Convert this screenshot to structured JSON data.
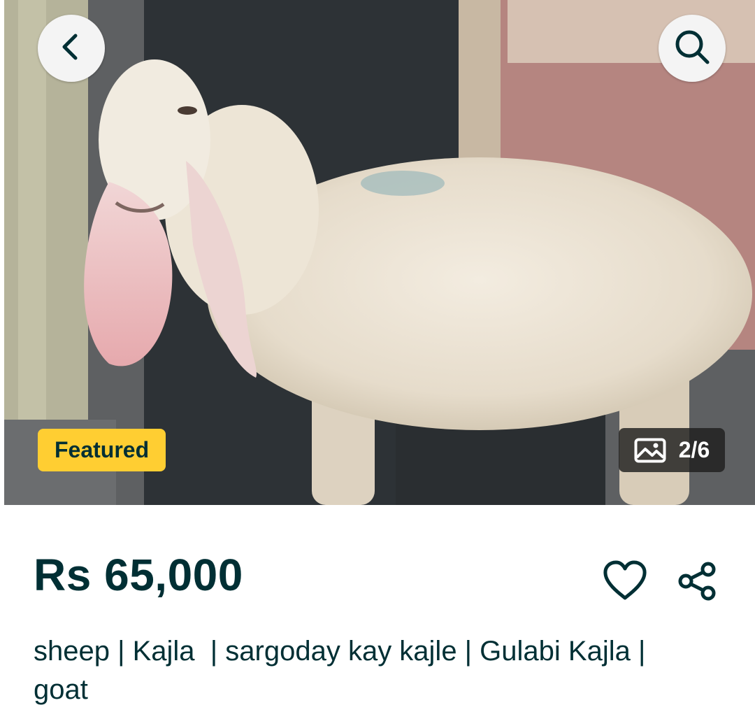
{
  "listing": {
    "badge": "Featured",
    "image_counter": "2/6",
    "price": "Rs 65,000",
    "title": "sheep | Kajla  | sargoday kay kajle | Gulabi Kajla | goat"
  },
  "icons": {
    "back": "chevron-left-icon",
    "search": "search-icon",
    "gallery": "image-icon",
    "favorite": "heart-icon",
    "share": "share-icon"
  },
  "colors": {
    "brand_text": "#002f34",
    "badge_bg": "#ffce32",
    "counter_bg": "#1e1e1e"
  }
}
